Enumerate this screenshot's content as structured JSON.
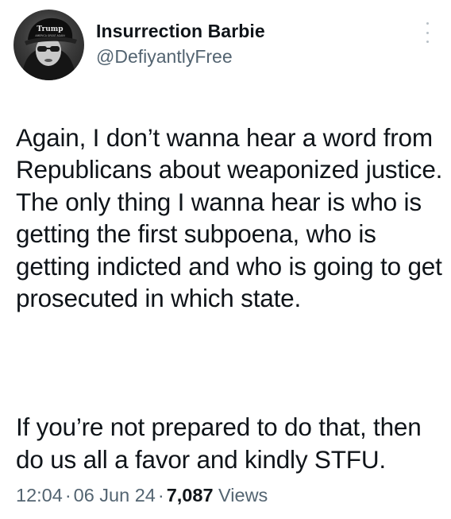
{
  "author": {
    "display_name": "Insurrection Barbie",
    "handle": "@DefiyantlyFree",
    "avatar_caption": "Trump",
    "avatar_caption_small": "AMERICA GREAT AGAIN"
  },
  "menu_icon": "more-vertical-icon",
  "tweet": {
    "paragraph_1": "Again, I don’t wanna hear a word from Republicans about weaponized justice. The only thing I wanna hear is who is getting the first subpoena, who is getting indicted and who is going to get prosecuted in which state.",
    "paragraph_2": "If you’re not prepared to do that, then do us all a favor and kindly STFU."
  },
  "meta": {
    "time": "12:04",
    "separator": "·",
    "date": "06 Jun 24",
    "views_count": "7,087",
    "views_label": "Views"
  },
  "colors": {
    "text_primary": "#0f1419",
    "text_secondary": "#536471",
    "background": "#ffffff"
  }
}
